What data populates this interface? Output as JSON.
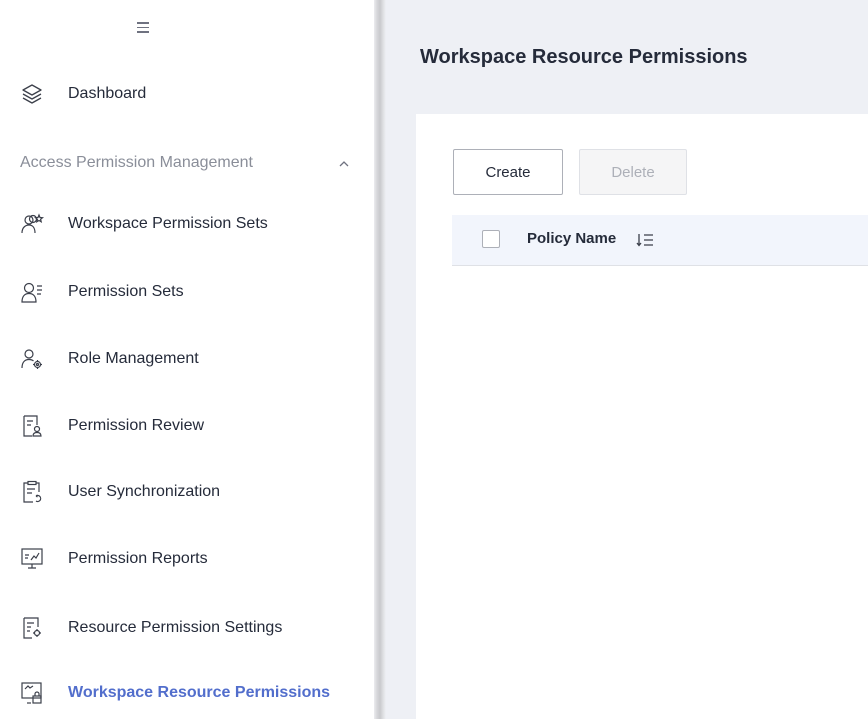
{
  "sidebar": {
    "menu_toggle_icon": "hamburger-icon",
    "dashboard": {
      "label": "Dashboard",
      "icon": "layers-icon"
    },
    "group": {
      "title": "Access Permission Management",
      "expanded": true,
      "chevron_icon": "chevron-up-icon"
    },
    "items": [
      {
        "label": "Workspace Permission Sets",
        "icon": "users-star-icon"
      },
      {
        "label": "Permission Sets",
        "icon": "user-list-icon"
      },
      {
        "label": "Role Management",
        "icon": "user-gear-icon"
      },
      {
        "label": "Permission Review",
        "icon": "document-user-icon"
      },
      {
        "label": "User Synchronization",
        "icon": "clipboard-sync-icon"
      },
      {
        "label": "Permission Reports",
        "icon": "monitor-chart-icon"
      },
      {
        "label": "Resource Permission Settings",
        "icon": "document-settings-icon"
      },
      {
        "label": "Workspace Resource Permissions",
        "icon": "resource-lock-icon",
        "active": true
      }
    ]
  },
  "main": {
    "title": "Workspace Resource Permissions",
    "toolbar": {
      "create_label": "Create",
      "delete_label": "Delete",
      "delete_disabled": true
    },
    "table": {
      "columns": [
        {
          "label": "Policy Name",
          "sortable": true,
          "sort_icon": "sort-icon"
        }
      ],
      "rows": []
    }
  },
  "colors": {
    "accent": "#526ecc",
    "text": "#252b3a",
    "muted": "#8a8e99",
    "main_bg": "#eef0f5",
    "table_header_bg": "#f2f5fc"
  }
}
